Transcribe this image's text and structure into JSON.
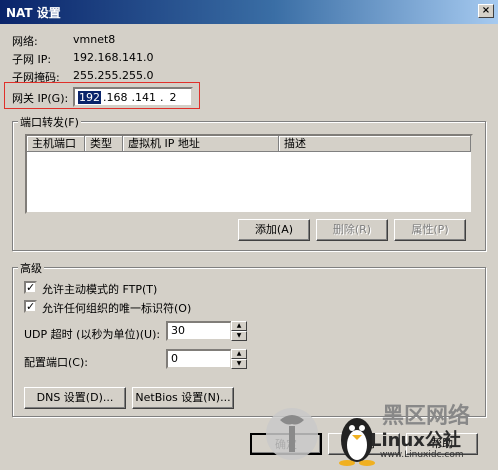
{
  "window": {
    "title": "NAT 设置",
    "close_glyph": "×"
  },
  "network": {
    "network_label": "网络:",
    "network_value": "vmnet8",
    "subnet_ip_label": "子网 IP:",
    "subnet_ip_value": "192.168.141.0",
    "subnet_mask_label": "子网掩码:",
    "subnet_mask_value": "255.255.255.0",
    "gateway_label": "网关 IP(G):",
    "gateway_octets": [
      "192",
      ".168",
      ".141",
      ".",
      "2"
    ]
  },
  "port_forwarding": {
    "title": "端口转发(F)",
    "columns": [
      "主机端口",
      "类型",
      "虚拟机 IP 地址",
      "描述"
    ],
    "rows": [],
    "add_label": "添加(A)",
    "remove_label": "删除(R)",
    "properties_label": "属性(P)"
  },
  "advanced": {
    "title": "高级",
    "allow_ftp_label": "允许主动模式的 FTP(T)",
    "allow_ftp_checked": true,
    "allow_oui_label": "允许任何组织的唯一标识符(O)",
    "allow_oui_checked": true,
    "udp_timeout_label": "UDP 超时 (以秒为单位)(U):",
    "udp_timeout_value": "30",
    "config_port_label": "配置端口(C):",
    "config_port_value": "0",
    "dns_button": "DNS 设置(D)...",
    "netbios_button": "NetBios 设置(N)..."
  },
  "footer": {
    "ok_label": "确定",
    "cancel_label": "取消",
    "help_label": "帮助"
  },
  "watermark": {
    "brand": "黑区网络",
    "site": "www.Linuxidc.com",
    "logo_text": "Linux公社"
  }
}
